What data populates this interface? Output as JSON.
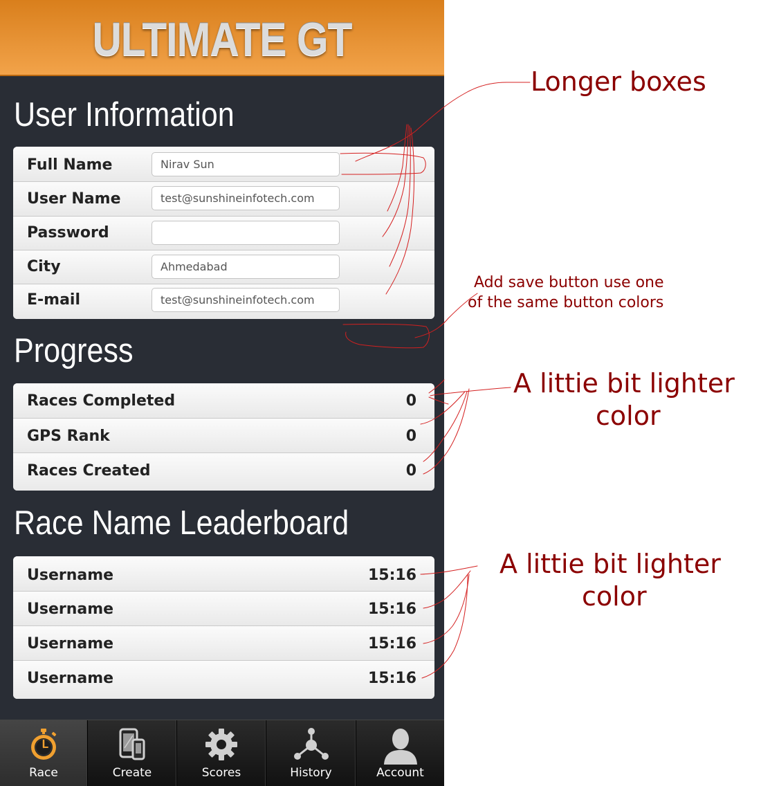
{
  "header": {
    "title": "ULTIMATE GT"
  },
  "user_info": {
    "title": "User Information",
    "fields": [
      {
        "label": "Full Name",
        "value": "Nirav Sun"
      },
      {
        "label": "User Name",
        "value": "test@sunshineinfotech.com"
      },
      {
        "label": "Password",
        "value": ""
      },
      {
        "label": "City",
        "value": "Ahmedabad"
      },
      {
        "label": "E-mail",
        "value": "test@sunshineinfotech.com"
      }
    ]
  },
  "progress": {
    "title": "Progress",
    "rows": [
      {
        "label": "Races Completed",
        "value": "0"
      },
      {
        "label": "GPS Rank",
        "value": "0"
      },
      {
        "label": "Races Created",
        "value": "0"
      }
    ]
  },
  "leaderboard": {
    "title": "Race Name Leaderboard",
    "rows": [
      {
        "label": "Username",
        "value": "15:16"
      },
      {
        "label": "Username",
        "value": "15:16"
      },
      {
        "label": "Username",
        "value": "15:16"
      },
      {
        "label": "Username",
        "value": "15:16"
      }
    ]
  },
  "tabbar": {
    "tabs": [
      {
        "label": "Race",
        "icon": "stopwatch-icon",
        "active": true
      },
      {
        "label": "Create",
        "icon": "devices-icon",
        "active": false
      },
      {
        "label": "Scores",
        "icon": "gear-icon",
        "active": false
      },
      {
        "label": "History",
        "icon": "network-icon",
        "active": false
      },
      {
        "label": "Account",
        "icon": "user-icon",
        "active": false
      }
    ]
  },
  "annotations": {
    "longer_boxes": "Longer boxes",
    "save_button_line1": "Add save button use one",
    "save_button_line2": "of the same button colors",
    "lighter_1_line1": "A littie bit lighter",
    "lighter_1_line2": "color",
    "lighter_2_line1": "A littie bit lighter",
    "lighter_2_line2": "color"
  },
  "colors": {
    "header_orange": "#e8902e",
    "panel_dark": "#292d35",
    "annotation_red": "#8b0000",
    "active_icon": "#f0a030"
  }
}
